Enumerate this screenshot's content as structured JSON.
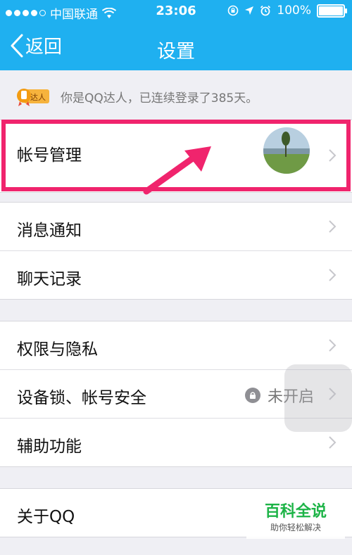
{
  "status_bar": {
    "carrier": "中国联通",
    "time": "23:06",
    "battery": "100%"
  },
  "nav": {
    "back_label": "返回",
    "title": "设置"
  },
  "vip": {
    "badge_text": "达人",
    "message": "你是QQ达人，已连续登录了385天。"
  },
  "groups": [
    {
      "items": [
        {
          "label": "帐号管理"
        }
      ]
    },
    {
      "items": [
        {
          "label": "消息通知"
        },
        {
          "label": "聊天记录"
        }
      ]
    },
    {
      "items": [
        {
          "label": "权限与隐私"
        },
        {
          "label": "设备锁、帐号安全",
          "value": "未开启"
        },
        {
          "label": "辅助功能"
        }
      ]
    },
    {
      "items": [
        {
          "label": "关于QQ"
        }
      ]
    }
  ],
  "watermark": {
    "title": "百科全说",
    "subtitle": "助你轻松解决"
  },
  "colors": {
    "header": "#1fb0f0",
    "highlight": "#f0246d",
    "watermark_green": "#1db447"
  }
}
